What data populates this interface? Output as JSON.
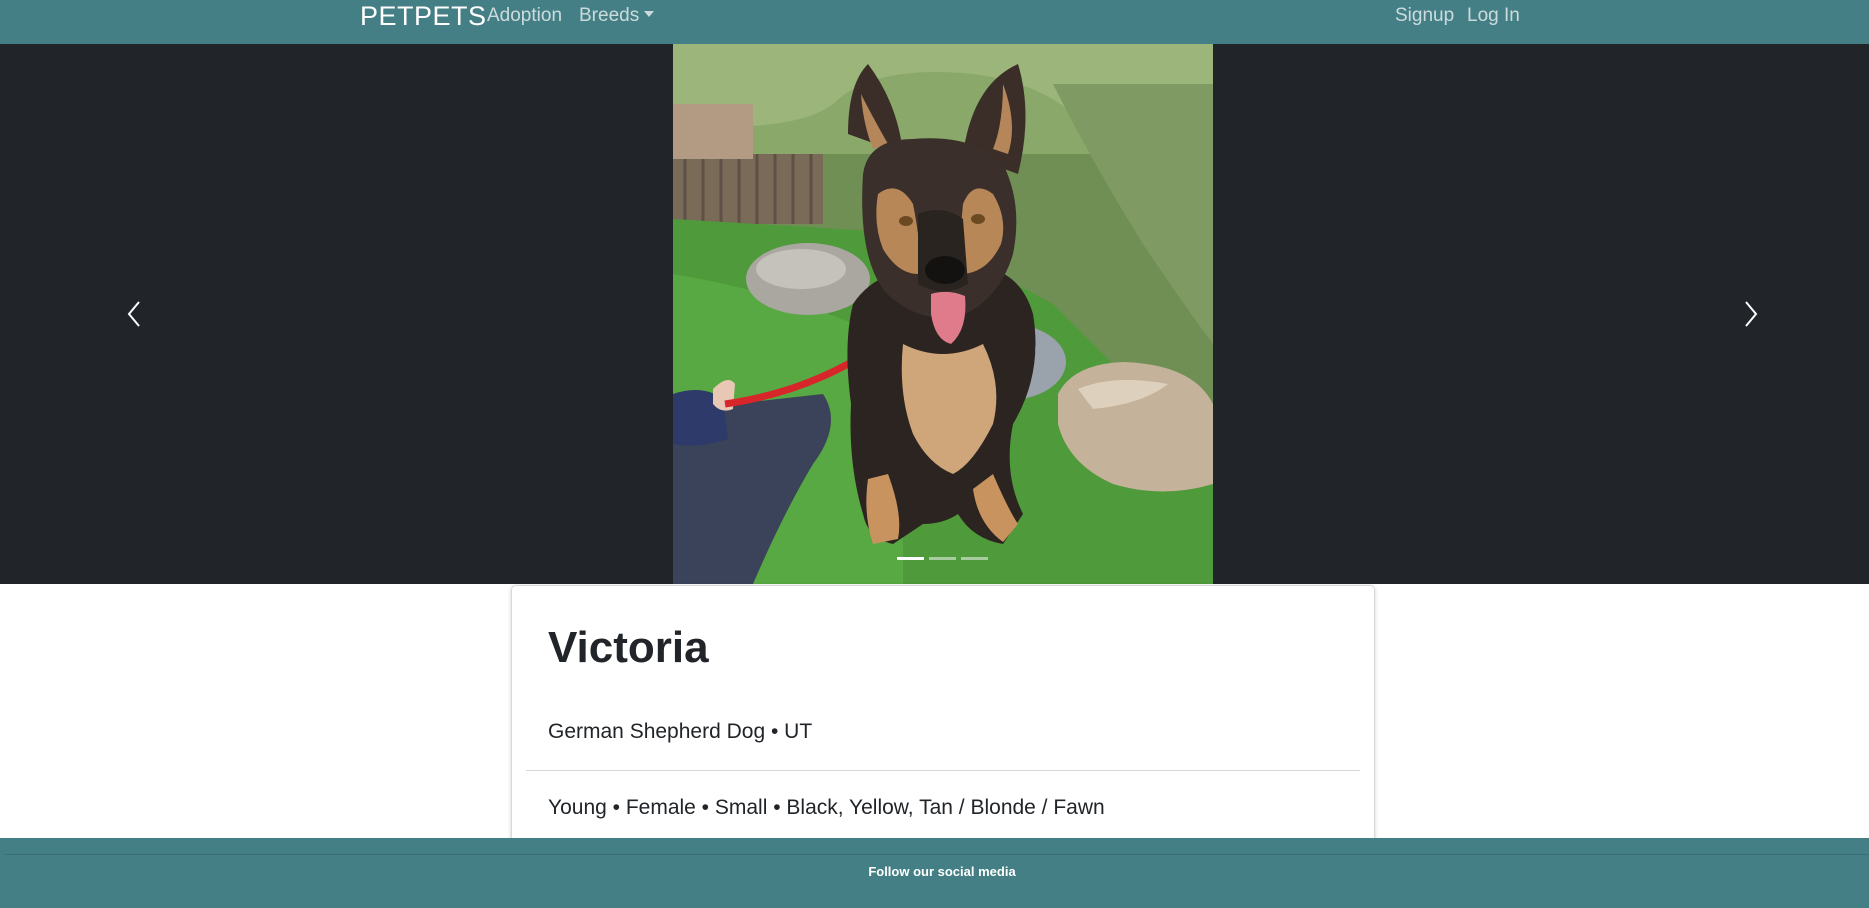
{
  "navbar": {
    "brand": "PETPETS",
    "adoption_label": "Adoption",
    "breeds_label": "Breeds",
    "signup_label": "Signup",
    "login_label": "Log In",
    "background_color": "#457f86"
  },
  "carousel": {
    "slide_count": 3,
    "active_slide": 1,
    "prev_icon": "chevron-left-icon",
    "next_icon": "chevron-right-icon",
    "background_color": "#212529"
  },
  "pet": {
    "name": "Victoria",
    "breed_location": "German Shepherd Dog • UT",
    "traits": "Young • Female • Small • Black, Yellow, Tan / Blonde / Fawn"
  },
  "footer": {
    "text": "Follow our social media",
    "background_color": "#457f86"
  }
}
